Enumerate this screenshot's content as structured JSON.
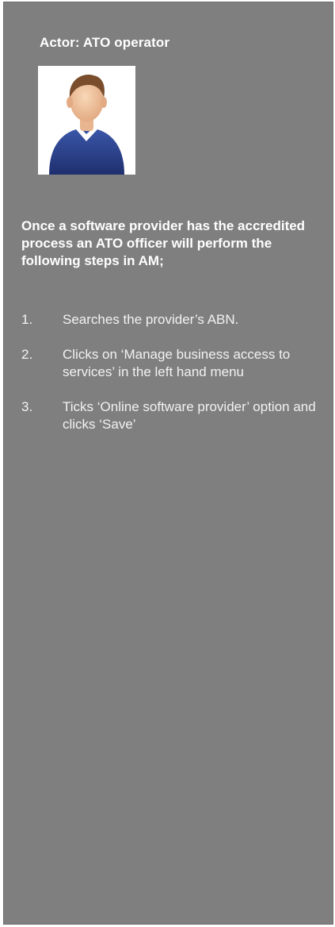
{
  "actor": {
    "title": "Actor: ATO operator",
    "avatar_icon": "person-avatar-icon"
  },
  "intro": "Once a software provider has the accredited process an ATO officer will perform the following steps in AM;",
  "steps": [
    {
      "number": "1.",
      "text": "Searches the provider’s ABN."
    },
    {
      "number": "2.",
      "text": "Clicks on ‘Manage business access to services’  in the left hand menu"
    },
    {
      "number": "3.",
      "text": "Ticks ‘Online software provider’ option and clicks ‘Save’"
    }
  ],
  "colors": {
    "panel_background": "#7f7f7f",
    "text": "#ffffff",
    "avatar_shirt": "#2a3f86",
    "avatar_skin": "#f2c7a1",
    "avatar_hair": "#7a4e2c"
  }
}
